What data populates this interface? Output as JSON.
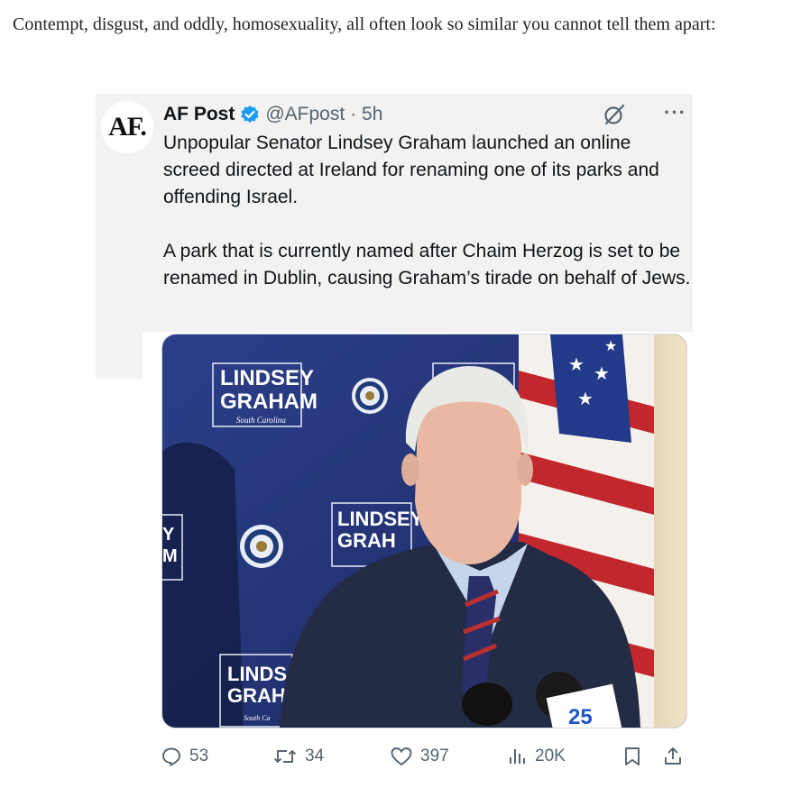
{
  "intro_text": "Contempt, disgust, and oddly, homosexuality, all often look so similar you cannot tell them apart:",
  "tweet": {
    "avatar_text": "AF.",
    "name": "AF Post",
    "handle": "@AFpost",
    "time": "· 5h",
    "more": "···",
    "paragraphs": [
      "Unpopular Senator Lindsey Graham launched an online screed directed at Ireland for renaming one of its parks and offending Israel.",
      "A park that is currently named after Chaim Herzog is set to be renamed in Dublin, causing Graham’s tirade on behalf of Jews."
    ],
    "image": {
      "backdrop_name": "LINDSEY",
      "backdrop_surname": "GRAHAM",
      "backdrop_state": "South Carolina",
      "backdrop_partial_1": "LINDSEY",
      "backdrop_partial_2": "GRAH",
      "backdrop_partial_3": "LINDS",
      "backdrop_partial_4": "GRAH",
      "backdrop_partial_5": "South Ca",
      "mic_flag": "25"
    },
    "actions": {
      "replies": "53",
      "reposts": "34",
      "likes": "397",
      "views": "20K"
    }
  },
  "colors": {
    "verified": "#1d9bf0",
    "muted": "#536471",
    "text": "#0f1419"
  }
}
